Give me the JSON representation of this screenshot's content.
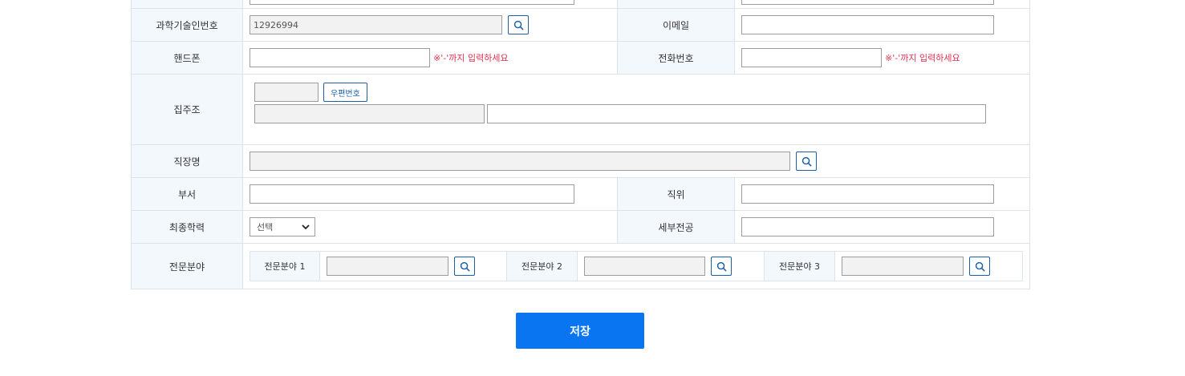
{
  "form": {
    "sci_id": {
      "label": "과학기술인번호",
      "value": "12926994"
    },
    "email": {
      "label": "이메일",
      "value": ""
    },
    "mobile": {
      "label": "핸드폰",
      "value": "",
      "note": "※'-'까지 입력하세요"
    },
    "phone": {
      "label": "전화번호",
      "value": "",
      "note": "※'-'까지 입력하세요"
    },
    "address": {
      "label": "집주조",
      "zip_button": "우편번호",
      "zip": "",
      "addr1": "",
      "addr2": ""
    },
    "workplace": {
      "label": "직장명",
      "value": ""
    },
    "department": {
      "label": "부서",
      "value": ""
    },
    "position": {
      "label": "직위",
      "value": ""
    },
    "education": {
      "label": "최종학력",
      "selected": "선택"
    },
    "major": {
      "label": "세부전공",
      "value": ""
    },
    "fields": {
      "label": "전문분야",
      "items": [
        {
          "label": "전문분야 1",
          "value": ""
        },
        {
          "label": "전문분야 2",
          "value": ""
        },
        {
          "label": "전문분야 3",
          "value": ""
        }
      ]
    }
  },
  "actions": {
    "save_label": "저장"
  },
  "icons": {
    "search": "search-icon",
    "select_arrow": "chevron-down-icon"
  },
  "colors": {
    "primary": "#0a75f0",
    "header_bg": "#f3f8fd",
    "border": "#dbe3ec",
    "note": "#e0314f",
    "icon_blue": "#1a5fa8"
  }
}
